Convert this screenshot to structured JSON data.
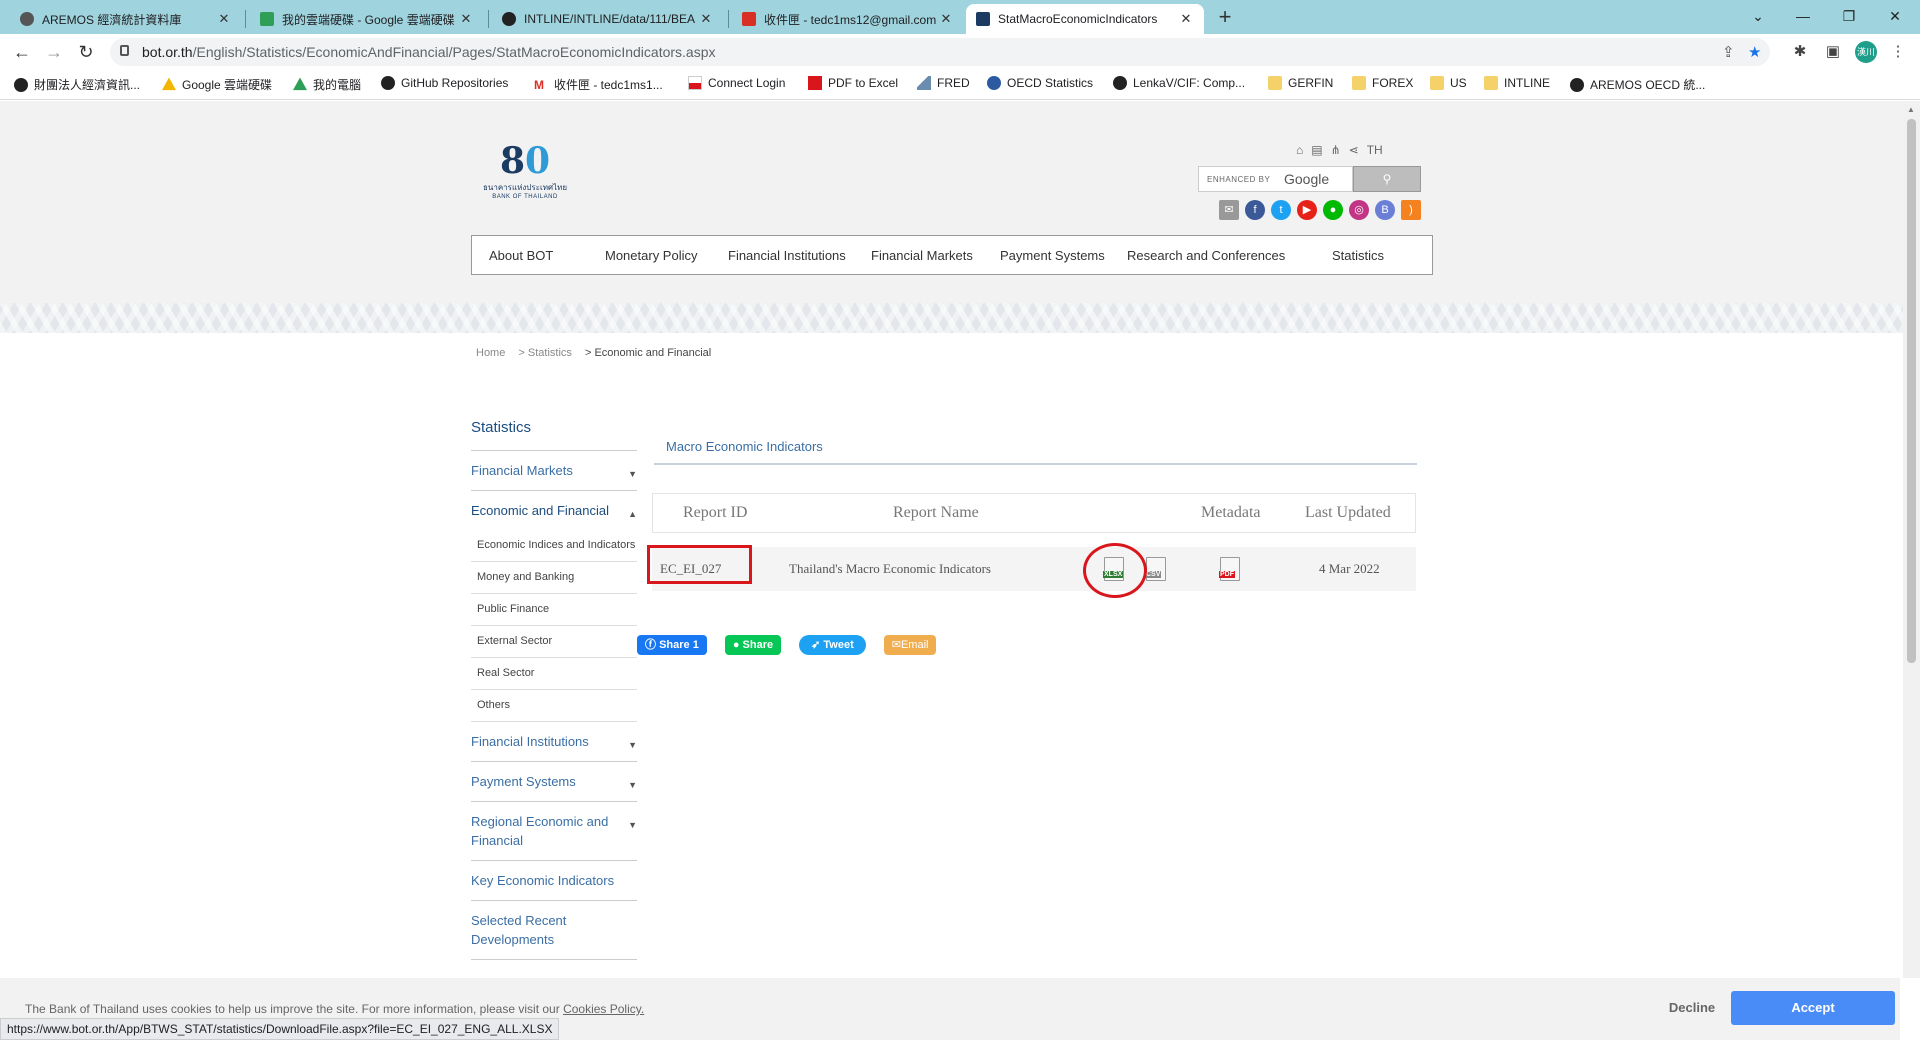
{
  "browser": {
    "tabs": [
      {
        "title": "AREMOS 經濟統計資料庫",
        "color": "#555555"
      },
      {
        "title": "我的雲端硬碟 - Google 雲端硬碟",
        "color": "#2f9e57"
      },
      {
        "title": "INTLINE/INTLINE/data/111/BEA",
        "color": "#222222"
      },
      {
        "title": "收件匣 - tedc1ms12@gmail.com",
        "color": "#d93025"
      },
      {
        "title": "StatMacroEconomicIndicators",
        "color": "#1c3b63"
      }
    ],
    "url_host": "bot.or.th",
    "url_path": "/English/Statistics/EconomicAndFinancial/Pages/StatMacroEconomicIndicators.aspx",
    "profile_label": "漢川",
    "bookmarks": [
      {
        "label": "財團法人經濟資訊...",
        "icon": "globe-icon"
      },
      {
        "label": "Google 雲端硬碟",
        "icon": "drive-icon"
      },
      {
        "label": "我的電腦",
        "icon": "drive-icon"
      },
      {
        "label": "GitHub Repositories",
        "icon": "github-icon"
      },
      {
        "label": "收件匣 - tedc1ms1...",
        "icon": "gmail-icon"
      },
      {
        "label": "Connect Login",
        "icon": "flag-icon"
      },
      {
        "label": "PDF to Excel",
        "icon": "pdf-icon"
      },
      {
        "label": "FRED",
        "icon": "chart-icon"
      },
      {
        "label": "OECD Statistics",
        "icon": "oecd-icon"
      },
      {
        "label": "LenkaV/CIF: Comp...",
        "icon": "github-icon"
      },
      {
        "label": "GERFIN",
        "icon": "folder-icon"
      },
      {
        "label": "FOREX",
        "icon": "folder-icon"
      },
      {
        "label": "US",
        "icon": "folder-icon"
      },
      {
        "label": "INTLINE",
        "icon": "folder-icon"
      },
      {
        "label": "AREMOS OECD 統...",
        "icon": "globe-icon"
      }
    ]
  },
  "site": {
    "logo_number": "8",
    "logo_zero": "0",
    "logo_thai": "ธนาคารแห่งประเทศไทย",
    "logo_english": "BANK OF THAILAND",
    "lang_toggle": "TH",
    "search_enhanced": "ENHANCED BY",
    "search_google": "Google",
    "nav": [
      "About BOT",
      "Monetary Policy",
      "Financial Institutions",
      "Financial Markets",
      "Payment Systems",
      "Research and Conferences",
      "Statistics"
    ],
    "breadcrumb": [
      "Home",
      "> Statistics",
      "> Economic and Financial"
    ]
  },
  "sidebar": {
    "title": "Statistics",
    "items": [
      {
        "label": "Financial Markets",
        "arrow": "▼"
      },
      {
        "label": "Economic and Financial",
        "arrow": "▲"
      },
      {
        "label": "Financial Institutions",
        "arrow": "▼"
      },
      {
        "label": "Payment Systems",
        "arrow": "▼"
      },
      {
        "label": "Regional Economic and Financial",
        "arrow": "▼"
      },
      {
        "label": "Key Economic Indicators",
        "arrow": ""
      },
      {
        "label": "Selected Recent Developments",
        "arrow": ""
      }
    ],
    "subitems": [
      "Economic Indices and Indicators",
      "Money and Banking",
      "Public Finance",
      "External Sector",
      "Real Sector",
      "Others"
    ]
  },
  "content": {
    "title": "Macro Economic Indicators",
    "headers": {
      "report_id": "Report ID",
      "report_name": "Report Name",
      "metadata": "Metadata",
      "last_updated": "Last Updated"
    },
    "row": {
      "report_id": "EC_EI_027",
      "report_name": "Thailand's Macro Economic Indicators",
      "xlsx": "XLSX",
      "csv": "CSV",
      "pdf": "PDF",
      "last_updated": "4 Mar 2022"
    },
    "share": {
      "facebook": "Share 1",
      "line": "Share",
      "twitter": "Tweet",
      "email": "Email"
    }
  },
  "cookie": {
    "text": "The Bank of Thailand uses cookies to help us improve the site. For more information, please visit our",
    "link": "Cookies Policy.",
    "decline": "Decline",
    "accept": "Accept"
  },
  "status_url": "https://www.bot.or.th/App/BTWS_STAT/statistics/DownloadFile.aspx?file=EC_EI_027_ENG_ALL.XLSX",
  "colors": {
    "accent": "#4a8cf7",
    "highlight": "#d9161c",
    "link": "#3a6ea5"
  }
}
